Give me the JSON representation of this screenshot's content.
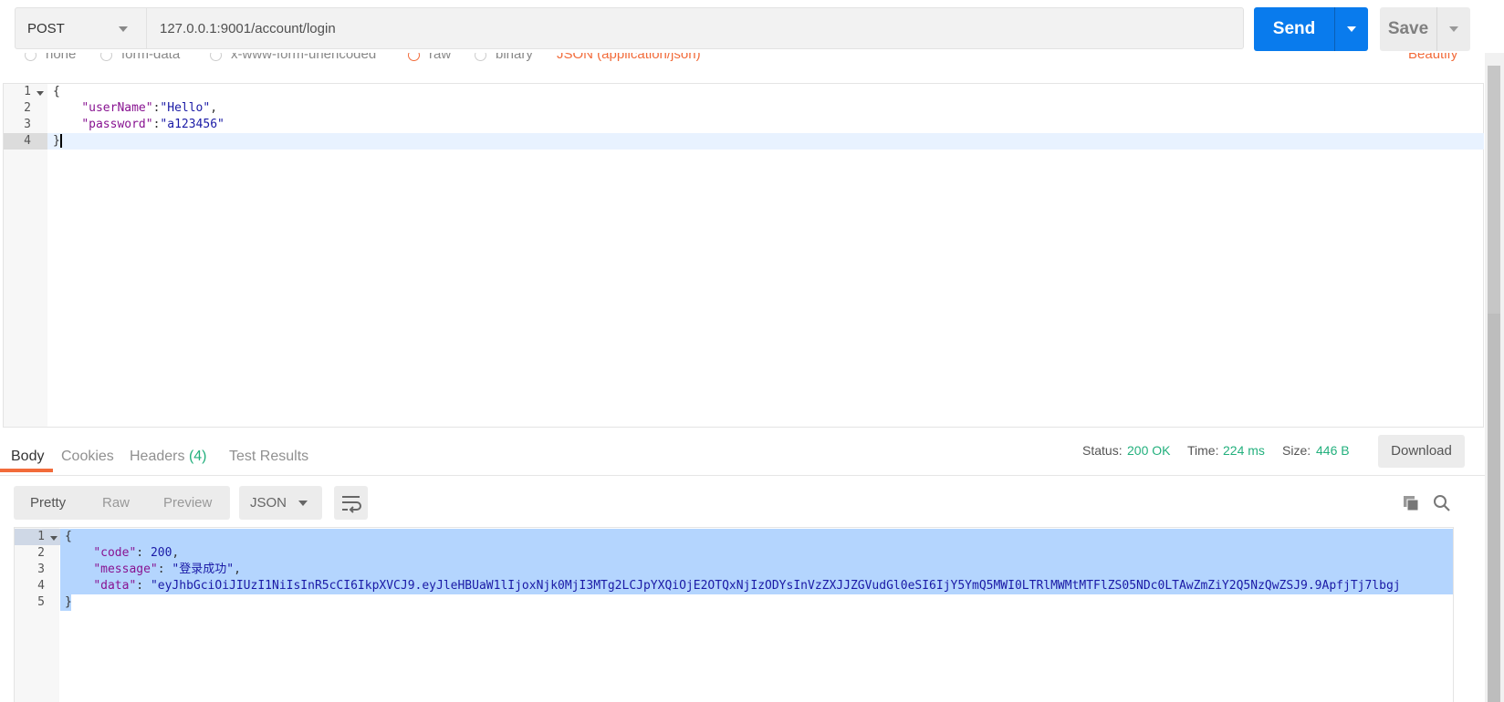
{
  "request": {
    "method": "POST",
    "url": "127.0.0.1:9001/account/login",
    "send_label": "Send",
    "save_label": "Save"
  },
  "body_types": {
    "none": "none",
    "form_data": "form-data",
    "urlencoded": "x-www-form-urlencoded",
    "raw": "raw",
    "binary": "binary",
    "json": "JSON (application/json)",
    "beautify": "Beautify"
  },
  "request_body": {
    "lines": [
      {
        "n": "1",
        "t": "{"
      },
      {
        "n": "2",
        "k": "\"userName\"",
        "s": ":",
        "v": "\"Hello\"",
        "e": ","
      },
      {
        "n": "3",
        "k": "\"password\"",
        "s": ":",
        "v": "\"a123456\"",
        "e": ""
      },
      {
        "n": "4",
        "t": "}"
      }
    ]
  },
  "response_tabs": {
    "body": "Body",
    "cookies": "Cookies",
    "headers": "Headers",
    "headers_count": "(4)",
    "test_results": "Test Results"
  },
  "response_meta": {
    "status_label": "Status:",
    "status_value": "200 OK",
    "time_label": "Time:",
    "time_value": "224 ms",
    "size_label": "Size:",
    "size_value": "446 B",
    "download_label": "Download"
  },
  "response_view": {
    "pretty": "Pretty",
    "raw": "Raw",
    "preview": "Preview",
    "format": "JSON"
  },
  "response_body": {
    "lines": [
      {
        "n": "1",
        "t": "{"
      },
      {
        "n": "2",
        "k": "\"code\"",
        "s": ": ",
        "v": "200",
        "e": ","
      },
      {
        "n": "3",
        "k": "\"message\"",
        "s": ": ",
        "v": "\"登录成功\"",
        "e": ","
      },
      {
        "n": "4",
        "k": "\"data\"",
        "s": ": ",
        "v": "\"eyJhbGciOiJIUzI1NiIsInR5cCI6IkpXVCJ9.eyJleHBUaW1lIjoxNjk0MjI3MTg2LCJpYXQiOjE2OTQxNjIzODYsInVzZXJJZGVudGl0eSI6IjY5YmQ5MWI0LTRlMWMtMTFlZS05NDc0LTAwZmZiY2Q5NzQwZSJ9.9ApfjTj7lbgj",
        "e": ""
      },
      {
        "n": "5",
        "t": "}"
      }
    ]
  },
  "icons": {
    "method_caret": "chevron-down-icon",
    "send_caret": "chevron-down-icon",
    "save_caret": "chevron-down-icon",
    "wrap": "wrap-lines-icon",
    "copy": "copy-icon",
    "search": "search-icon"
  },
  "colors": {
    "send": "#097bed",
    "accent": "#f26b3a",
    "status_green": "#23b07d",
    "selection": "#b4d5fe"
  }
}
